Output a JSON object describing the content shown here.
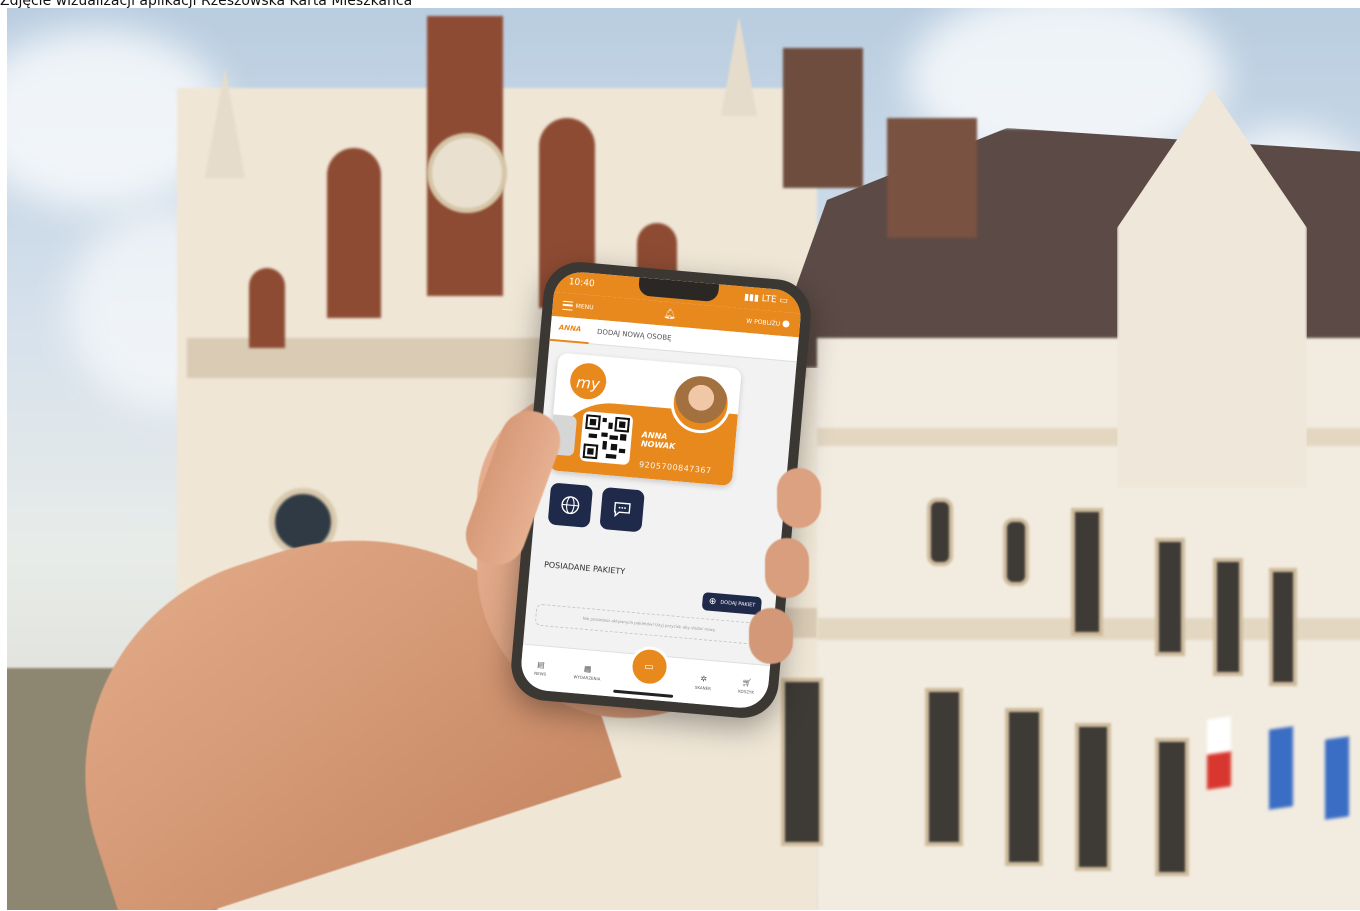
{
  "caption": "Zdjęcie wizualizacji aplikacji Rzeszowska Karta Mieszkańca",
  "status_bar": {
    "time": "10:40",
    "network": "LTE"
  },
  "top_bar": {
    "menu_label": "MENU",
    "nearby_label": "W POBLIŻU"
  },
  "tabs": [
    {
      "label": "ANNA",
      "active": true
    },
    {
      "label": "DODAJ NOWĄ OSOBĘ",
      "active": false
    }
  ],
  "card": {
    "logo_text": "my",
    "first_name": "ANNA",
    "last_name": "NOWAK",
    "number": "9205700847367"
  },
  "packages": {
    "title": "POSIADANE PAKIETY",
    "add_button": "DODAJ PAKIET",
    "empty_text": "Nie posiadasz aktywnych pakietów! Użyj przycisk aby dodać nowy."
  },
  "bottom_nav": [
    {
      "label": "NEWS",
      "icon": "news-icon"
    },
    {
      "label": "WYDARZENIA",
      "icon": "calendar-icon"
    },
    {
      "label": "",
      "icon": "card-icon"
    },
    {
      "label": "SKANER",
      "icon": "scanner-icon"
    },
    {
      "label": "KOSZYK",
      "icon": "cart-icon"
    }
  ],
  "colors": {
    "accent": "#e8891e",
    "navy": "#1f2a4a"
  }
}
